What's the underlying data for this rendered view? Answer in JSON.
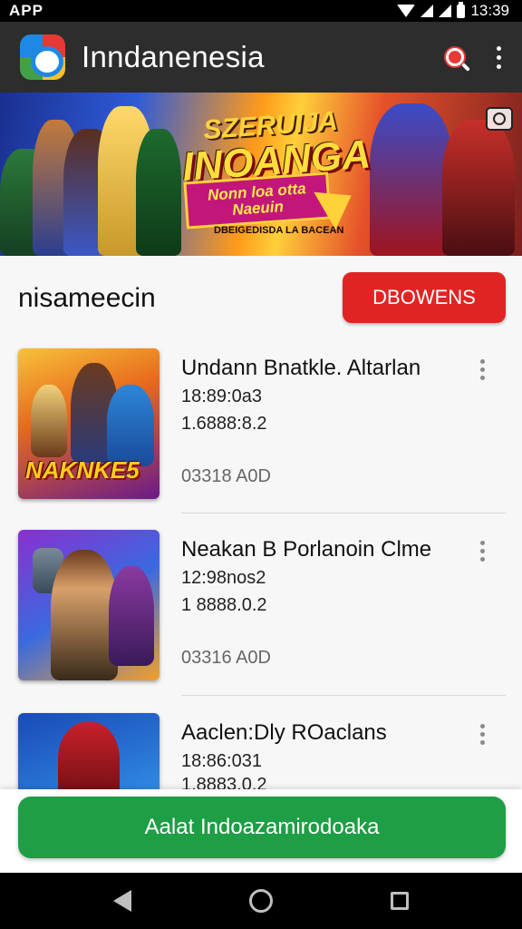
{
  "status_bar": {
    "left": "APP",
    "time": "13:39"
  },
  "app_bar": {
    "title": "Inndanenesia"
  },
  "banner": {
    "kicker": "SZERUIJA",
    "title": "INOANGA",
    "ribbon_line1": "Nonn loa otta",
    "ribbon_line2": "Naeuin",
    "tagline": "DBEIGEDISDA LA BACEAN"
  },
  "section": {
    "title": "nisameecin",
    "browse_label": "DBOWENS"
  },
  "games": [
    {
      "name": "Undann Bnatkle. Altarlan",
      "line1": "18:89:0a3",
      "line2": "1.6888:8.2",
      "size": "03318 A0D",
      "thumb_logo": "NAKNKE5"
    },
    {
      "name": "Neakan B Porlanoin Clme",
      "line1": "12:98nos2",
      "line2": "1 8888.0.2",
      "size": "03316 A0D",
      "thumb_logo": ""
    },
    {
      "name": "Aaclen:Dly ROaclans",
      "line1": "18:86:031",
      "line2": "1.8883.0.2",
      "size": "",
      "thumb_logo": ""
    }
  ],
  "cta": {
    "label": "Aalat Indoazamirodoaka"
  },
  "colors": {
    "accent_red": "#e02424",
    "accent_green": "#1e9e45",
    "app_bar": "#2d2d2d"
  },
  "icons": [
    "wifi-icon",
    "signal-icon",
    "battery-icon",
    "app-logo-icon",
    "search-icon",
    "more-vert-icon",
    "camera-icon",
    "back-icon",
    "home-icon",
    "recents-icon"
  ]
}
